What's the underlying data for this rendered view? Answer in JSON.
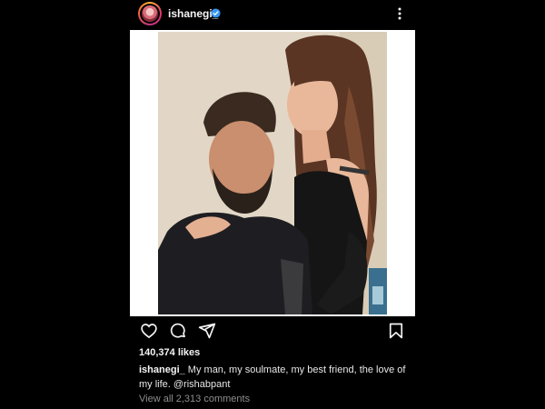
{
  "header": {
    "username": "ishanegi_",
    "verified_icon": "verified-badge-icon",
    "more_icon": "more-vertical-icon"
  },
  "actions": {
    "like_icon": "heart-icon",
    "comment_icon": "comment-icon",
    "share_icon": "send-icon",
    "save_icon": "bookmark-icon"
  },
  "likes": "140,374 likes",
  "caption": {
    "username": "ishanegi_",
    "text": " My man, my soulmate, my best friend, the love of my life. @rishabpant"
  },
  "comments_link": "View all 2,313 comments",
  "colors": {
    "background": "#000000",
    "text": "#f5f5f5",
    "muted": "#8e8e8e",
    "verified": "#3897f0"
  }
}
